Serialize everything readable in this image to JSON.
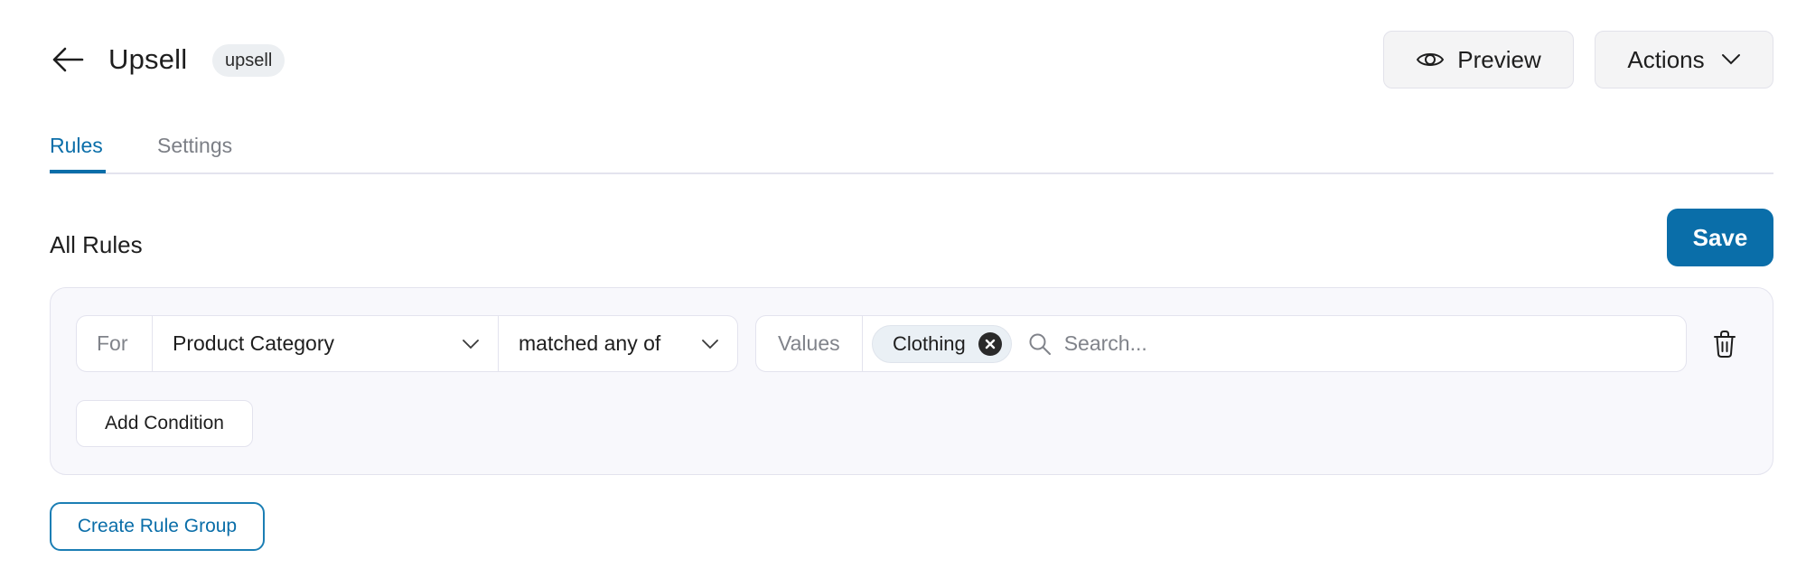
{
  "header": {
    "back_icon": "arrow-left-icon",
    "title": "Upsell",
    "badge": "upsell",
    "preview_label": "Preview",
    "preview_icon": "eye-icon",
    "actions_label": "Actions",
    "actions_icon": "chevron-down-icon"
  },
  "tabs": [
    {
      "label": "Rules",
      "active": true
    },
    {
      "label": "Settings",
      "active": false
    }
  ],
  "rules": {
    "heading": "All Rules",
    "save_label": "Save",
    "groups": [
      {
        "conditions": [
          {
            "for_label": "For",
            "field": "Product Category",
            "operator": "matched any of",
            "values_label": "Values",
            "values": [
              "Clothing"
            ],
            "search_placeholder": "Search..."
          }
        ],
        "add_condition_label": "Add Condition"
      }
    ],
    "create_group_label": "Create Rule Group"
  },
  "colors": {
    "accent": "#0a6ea9",
    "panel_bg": "#f8f8fc",
    "border": "#e3e3ee",
    "muted_text": "#80838a"
  }
}
